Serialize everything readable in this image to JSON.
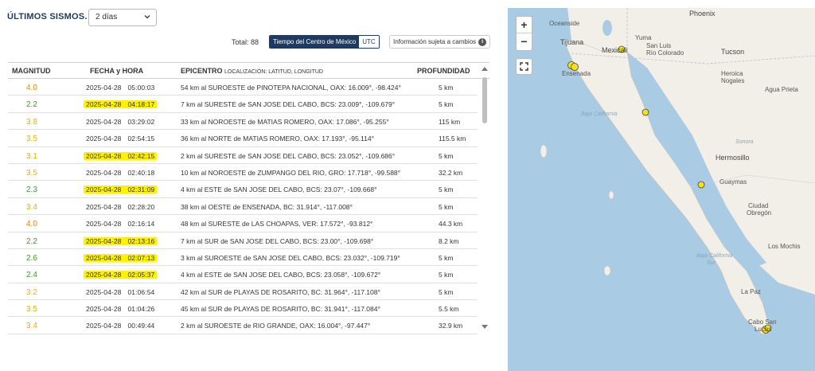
{
  "header": {
    "title": "ÚLTIMOS SISMOS.",
    "period_select": "2 días",
    "total": "Total: 88",
    "time_toggle": [
      "Tiempo del Centro de México",
      "UTC"
    ],
    "info_button": "Información sujeta a cambios",
    "info_icon": "info-icon"
  },
  "table": {
    "columns": {
      "magnitud": "MAGNITUD",
      "fecha": "FECHA y HORA",
      "epicentro": "EPICENTRO",
      "epicentro_sub": "LOCALIZACIÓN: LATITUD, LONGITUD",
      "profundidad": "PROFUNDIDAD"
    },
    "rows": [
      {
        "mag": "4.0",
        "date": "2025-04-28",
        "time": "05:00:03",
        "epi": "54 km al SUROESTE de PINOTEPA NACIONAL, OAX: 16.009°, -98.424°",
        "prof": "5 km",
        "color": "#e08a00",
        "hl": false
      },
      {
        "mag": "2.2",
        "date": "2025-04-28",
        "time": "04:18:17",
        "epi": "7 km al SURESTE de SAN JOSE DEL CABO, BCS: 23.009°, -109.679°",
        "prof": "5 km",
        "color": "#3c9a2f",
        "hl": true
      },
      {
        "mag": "3.8",
        "date": "2025-04-28",
        "time": "03:29:02",
        "epi": "33 km al NOROESTE de MATIAS ROMERO, OAX: 17.086°, -95.255°",
        "prof": "115 km",
        "color": "#e0b800",
        "hl": false
      },
      {
        "mag": "3.5",
        "date": "2025-04-28",
        "time": "02:54:15",
        "epi": "36 km al NORTE de MATIAS ROMERO, OAX: 17.193°, -95.114°",
        "prof": "115.5 km",
        "color": "#e0b800",
        "hl": false
      },
      {
        "mag": "3.1",
        "date": "2025-04-28",
        "time": "02:42:15",
        "epi": "2 km al SURESTE de SAN JOSE DEL CABO, BCS: 23.052°, -109.686°",
        "prof": "5 km",
        "color": "#e0b800",
        "hl": true
      },
      {
        "mag": "3.5",
        "date": "2025-04-28",
        "time": "02:40:18",
        "epi": "10 km al NOROESTE de ZUMPANGO DEL RIO, GRO: 17.718°, -99.588°",
        "prof": "32.2 km",
        "color": "#e0b800",
        "hl": false
      },
      {
        "mag": "2.3",
        "date": "2025-04-28",
        "time": "02:31:09",
        "epi": "4 km al ESTE de SAN JOSE DEL CABO, BCS: 23.07°, -109.668°",
        "prof": "5 km",
        "color": "#3c9a2f",
        "hl": true
      },
      {
        "mag": "3.4",
        "date": "2025-04-28",
        "time": "02:28:20",
        "epi": "38 km al OESTE de ENSENADA, BC: 31.914°, -117.008°",
        "prof": "5 km",
        "color": "#e0b800",
        "hl": false
      },
      {
        "mag": "4.0",
        "date": "2025-04-28",
        "time": "02:16:14",
        "epi": "48 km al SURESTE de LAS CHOAPAS, VER: 17.572°, -93.812°",
        "prof": "44.3 km",
        "color": "#e08a00",
        "hl": false
      },
      {
        "mag": "2.2",
        "date": "2025-04-28",
        "time": "02:13:16",
        "epi": "7 km al SUR de SAN JOSE DEL CABO, BCS: 23.00°, -109.698°",
        "prof": "8.2 km",
        "color": "#3c9a2f",
        "hl": true
      },
      {
        "mag": "2.6",
        "date": "2025-04-28",
        "time": "02:07:13",
        "epi": "3 km al SUROESTE de SAN JOSE DEL CABO, BCS: 23.032°, -109.719°",
        "prof": "5 km",
        "color": "#3c9a2f",
        "hl": true
      },
      {
        "mag": "2.4",
        "date": "2025-04-28",
        "time": "02:05:37",
        "epi": "4 km al ESTE de SAN JOSE DEL CABO, BCS: 23.058°, -109.672°",
        "prof": "5 km",
        "color": "#3c9a2f",
        "hl": true
      },
      {
        "mag": "3.2",
        "date": "2025-04-28",
        "time": "01:06:54",
        "epi": "42 km al SUR de PLAYAS DE ROSARITO, BC: 31.964°, -117.108°",
        "prof": "5 km",
        "color": "#e0b800",
        "hl": false
      },
      {
        "mag": "3.5",
        "date": "2025-04-28",
        "time": "01:04:26",
        "epi": "45 km al SUR de PLAYAS DE ROSARITO, BC: 31.941°, -117.084°",
        "prof": "5.5 km",
        "color": "#e0b800",
        "hl": false
      },
      {
        "mag": "3.4",
        "date": "2025-04-28",
        "time": "00:49:44",
        "epi": "2 km al SUROESTE de RIO GRANDE, OAX: 16.004°, -97.447°",
        "prof": "32.9 km",
        "color": "#e0b800",
        "hl": false
      }
    ]
  },
  "map": {
    "zoom_in": "+",
    "zoom_out": "−",
    "fullscreen_icon": "fullscreen-icon",
    "labels": {
      "phoenix": "Phoenix",
      "oceanside": "Oceanside",
      "tijuana": "Tijuana",
      "mexicali": "Mexicali",
      "san_luis": "San Luis",
      "san_luis2": "Río Colorado",
      "yuma": "Yuma",
      "tucson": "Tucson",
      "ensenada": "Ensenada",
      "heroica1": "Heroica",
      "heroica2": "Nogales",
      "agua_prieta": "Agua Prieta",
      "baja": "Baja California",
      "sonora": "Sonora",
      "hermosillo": "Hermosillo",
      "guaymas": "Guaymas",
      "obregon1": "Ciudad",
      "obregon2": "Obregón",
      "baja_sur1": "Baja California",
      "baja_sur2": "Sur",
      "los_mochis": "Los Mochis",
      "la_paz": "La Paz",
      "cabo1": "Cabo San",
      "cabo2": "Lucas"
    }
  }
}
